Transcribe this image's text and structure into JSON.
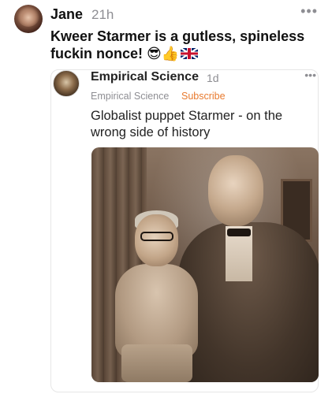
{
  "post": {
    "author": "Jane",
    "time": "21h",
    "more": "•••",
    "text": "Kweer Starmer is a gutless, spineless fuckin nonce!",
    "emojis": [
      "😎",
      "👍"
    ]
  },
  "embed": {
    "title": "Empirical Science",
    "time": "1d",
    "more": "•••",
    "publication": "Empirical Science",
    "subscribe_label": "Subscribe",
    "text": "Globalist puppet Starmer - on the wrong side of history"
  },
  "colors": {
    "subscribe": "#e87a2e",
    "muted": "#8e8e93"
  }
}
